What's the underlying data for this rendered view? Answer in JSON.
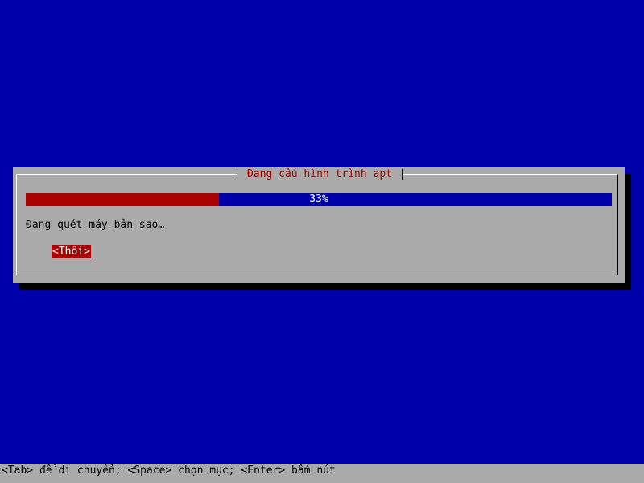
{
  "dialog": {
    "title": "Đang cấu hình trình apt",
    "progress": {
      "percent": 33,
      "label": "33%"
    },
    "status_text": "Đang quét máy bản sao…",
    "cancel_label": "<Thôi>"
  },
  "help_bar": {
    "text": "<Tab> để di chuyển; <Space> chọn mục; <Enter> bấm nút"
  },
  "colors": {
    "background": "#0000AA",
    "dialog": "#AAAAAA",
    "accent": "#AA0000",
    "shadow": "#000000"
  }
}
